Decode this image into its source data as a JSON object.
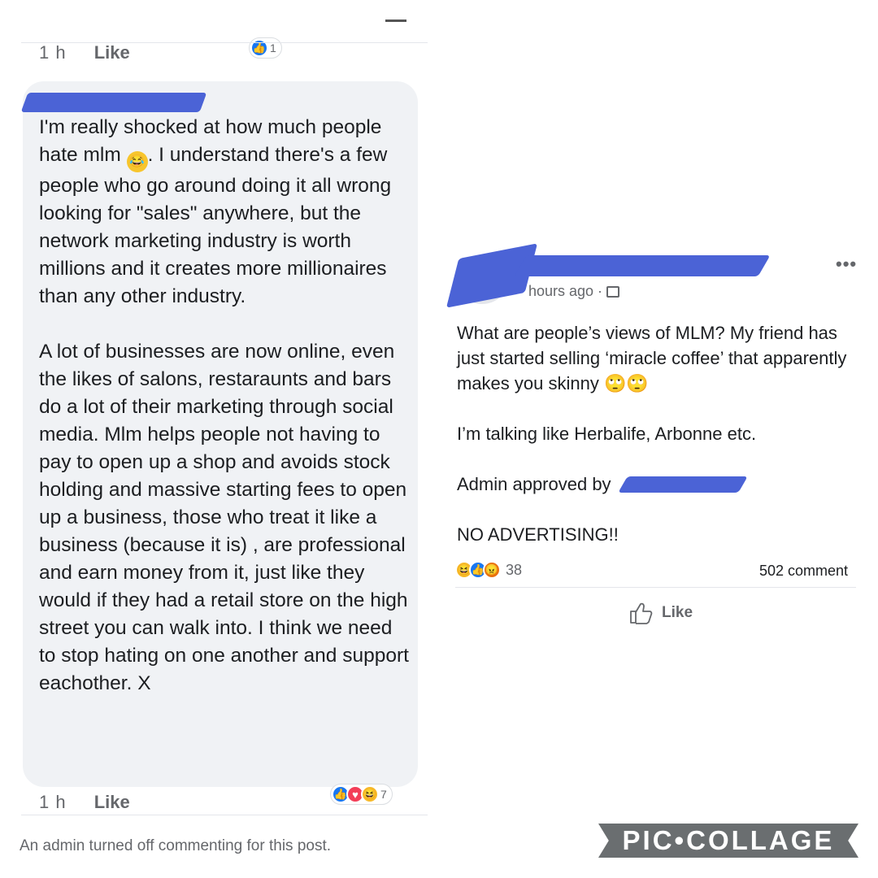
{
  "comment_top_meta": {
    "time": "1 h",
    "like": "Like",
    "reaction_count": "1"
  },
  "comment": {
    "paragraph1_a": "I'm really shocked at how much people hate mlm ",
    "paragraph1_b": ". I understand there's a few people who go around doing it all wrong looking for \"sales\" anywhere, but the network marketing industry is worth millions and it creates more millionaires than any other industry.",
    "paragraph2": "A lot of businesses are now online, even the likes of salons, restaraunts and bars do a lot of their marketing through social media. Mlm helps people not having to pay to open up a shop and avoids stock holding and massive starting fees to open up a business, those who treat it like a business (because it is) , are professional and earn money from it, just like they would if they had a retail store on the high street you can walk into. I think we need to stop hating on one another and support eachother. X"
  },
  "comment_bottom_meta": {
    "time": "1 h",
    "like": "Like",
    "reaction_count": "7"
  },
  "admin_note": "An admin turned off commenting for this post.",
  "post": {
    "time_meta": "hours ago ·",
    "more": "•••",
    "line1": "What are people’s views of MLM? My friend has just started selling ‘miracle coffee’ that apparently makes you skinny ",
    "line2": "I’m talking like Herbalife, Arbonne etc.",
    "line3": "Admin approved by",
    "line4": "NO ADVERTISING!!",
    "reaction_count": "38",
    "comments": "502 comment",
    "like_action": "Like"
  },
  "watermark": "PIC•COLLAGE",
  "colors": {
    "redaction": "#4b63d6",
    "bubble": "#f0f2f5",
    "watermark": "#6a6e70"
  }
}
